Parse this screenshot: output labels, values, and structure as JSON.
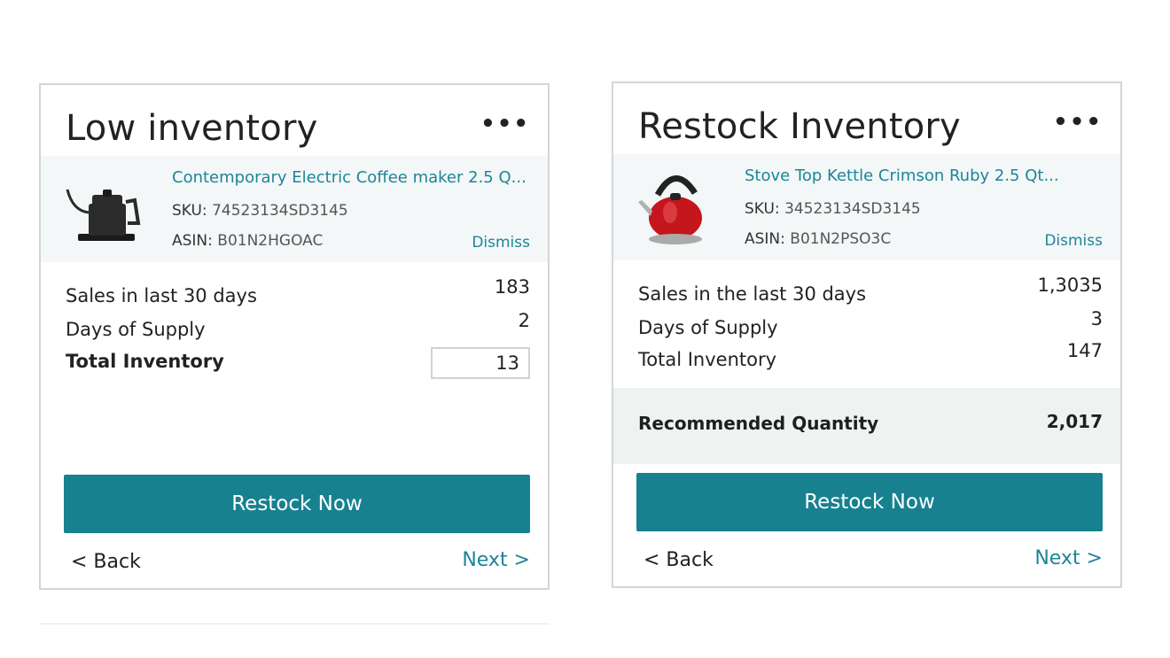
{
  "cards": [
    {
      "title": "Low inventory",
      "more": "•••",
      "product": {
        "name": "Contemporary Electric Coffee maker 2.5 Q...",
        "sku_label": "SKU:",
        "sku": "74523134SD3145",
        "asin_label": "ASIN:",
        "asin": "B01N2HGOAC",
        "dismiss": "Dismiss",
        "image_icon": "electric-kettle-icon"
      },
      "rows": [
        {
          "label": "Sales in last 30 days",
          "value": "183"
        },
        {
          "label": "Days of Supply",
          "value": "2"
        },
        {
          "label": "Total Inventory",
          "value": "13"
        }
      ],
      "button": "Restock Now",
      "back": "< Back",
      "next": "Next >"
    },
    {
      "title": "Restock Inventory",
      "more": "•••",
      "product": {
        "name": "Stove Top Kettle Crimson Ruby 2.5 Qt...",
        "sku_label": "SKU:",
        "sku": "34523134SD3145",
        "asin_label": "ASIN:",
        "asin": "B01N2PSO3C",
        "dismiss": "Dismiss",
        "image_icon": "stove-kettle-icon"
      },
      "rows": [
        {
          "label": "Sales in the last 30 days",
          "value": "1,3035"
        },
        {
          "label": "Days of Supply",
          "value": "3"
        },
        {
          "label": "Total Inventory",
          "value": "147"
        }
      ],
      "recommended": {
        "label": "Recommended Quantity",
        "value": "2,017"
      },
      "button": "Restock Now",
      "back": "< Back",
      "next": "Next >"
    }
  ],
  "colors": {
    "accent": "#17818f",
    "link": "#1d8597",
    "product_bg": "#f3f7f8",
    "recommend_bg": "#eef2f0"
  }
}
